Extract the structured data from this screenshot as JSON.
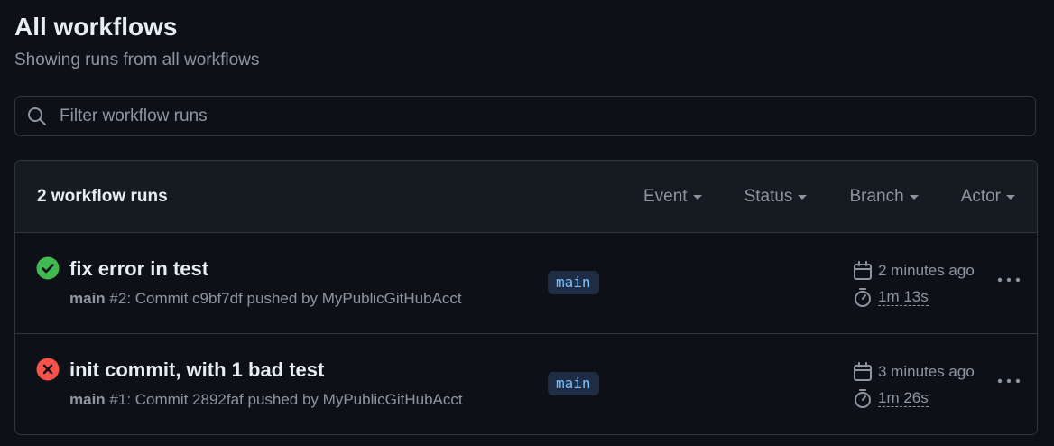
{
  "header": {
    "title": "All workflows",
    "subtitle": "Showing runs from all workflows"
  },
  "filter": {
    "placeholder": "Filter workflow runs",
    "value": ""
  },
  "runs_box": {
    "count_label": "2 workflow runs",
    "filters": [
      {
        "label": "Event"
      },
      {
        "label": "Status"
      },
      {
        "label": "Branch"
      },
      {
        "label": "Actor"
      }
    ]
  },
  "runs": [
    {
      "status": "success",
      "title": "fix error in test",
      "branch_bold": "main",
      "meta": " #2: Commit c9bf7df pushed by MyPublicGitHubAcct",
      "branch_pill": "main",
      "when": "2 minutes ago",
      "duration": "1m 13s"
    },
    {
      "status": "failure",
      "title": "init commit, with 1 bad test",
      "branch_bold": "main",
      "meta": " #1: Commit 2892faf pushed by MyPublicGitHubAcct",
      "branch_pill": "main",
      "when": "3 minutes ago",
      "duration": "1m 26s"
    }
  ],
  "colors": {
    "background": "#0d1117",
    "success": "#3fb950",
    "failure": "#f85149",
    "branch_text": "#79c0ff",
    "branch_bg": "#1f2d44",
    "muted": "#8d96a0"
  },
  "icons": {
    "search": "search-icon",
    "success": "check-circle-icon",
    "failure": "x-circle-icon",
    "calendar": "calendar-icon",
    "stopwatch": "stopwatch-icon",
    "more": "kebab-horizontal-icon"
  }
}
